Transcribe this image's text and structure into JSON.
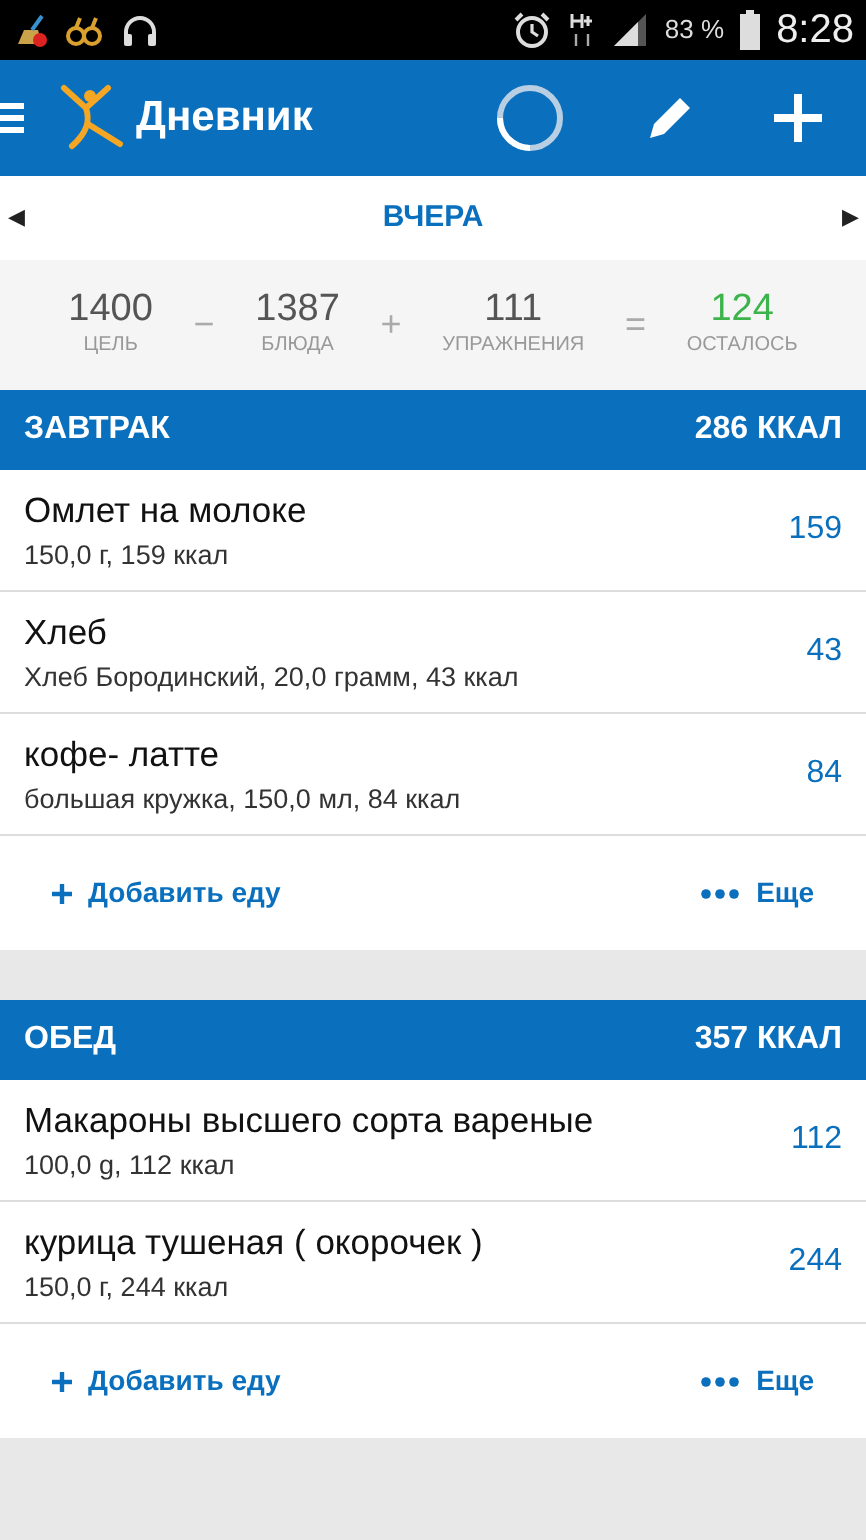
{
  "status_bar": {
    "battery": "83 %",
    "time": "8:28"
  },
  "app_bar": {
    "title": "Дневник"
  },
  "date_nav": {
    "prev": "◀",
    "label": "ВЧЕРА",
    "next": "▶"
  },
  "summary": [
    {
      "kind": "value",
      "value": "1400",
      "label": "ЦЕЛЬ"
    },
    {
      "kind": "operator",
      "value": "−"
    },
    {
      "kind": "value",
      "value": "1387",
      "label": "БЛЮДА"
    },
    {
      "kind": "operator",
      "value": "+"
    },
    {
      "kind": "value",
      "value": "111",
      "label": "УПРАЖНЕНИЯ"
    },
    {
      "kind": "operator",
      "value": "="
    },
    {
      "kind": "remaining",
      "value": "124",
      "label": "ОСТАЛОСЬ"
    }
  ],
  "meals": [
    {
      "title": "ЗАВТРАК",
      "total": "286 ККАЛ",
      "items": [
        {
          "name": "Омлет на молоке",
          "detail": "150,0 г, 159 ккал",
          "calories": "159"
        },
        {
          "name": "Хлеб",
          "detail": "Хлеб Бородинский, 20,0 грамм, 43 ккал",
          "calories": "43"
        },
        {
          "name": "кофе- латте",
          "detail": "большая кружка, 150,0 мл, 84 ккал",
          "calories": "84"
        }
      ],
      "add_label": "Добавить еду",
      "more_label": "Еще"
    },
    {
      "title": "ОБЕД",
      "total": "357 ККАЛ",
      "items": [
        {
          "name": "Макароны высшего сорта вареные",
          "detail": "100,0 g, 112 ккал",
          "calories": "112"
        },
        {
          "name": "курица тушеная ( окорочек )",
          "detail": "150,0 г, 244 ккал",
          "calories": "244"
        }
      ],
      "add_label": "Добавить еду",
      "more_label": "Еще"
    }
  ]
}
